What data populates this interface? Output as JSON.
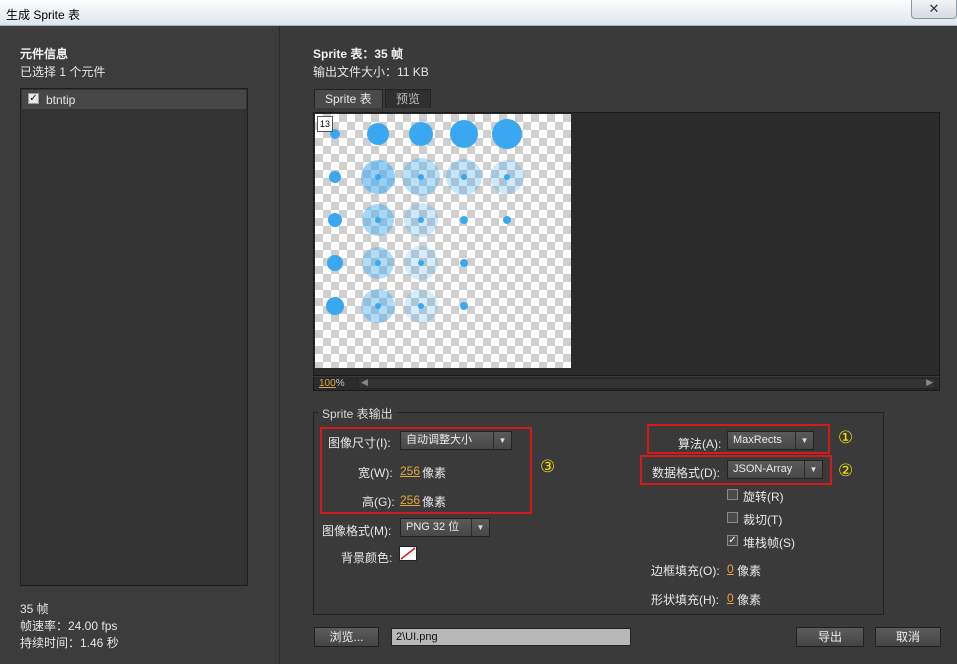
{
  "window": {
    "title": "生成 Sprite 表",
    "close_glyph": "✕"
  },
  "left": {
    "header": "元件信息",
    "selected_count": "已选择 1 个元件",
    "symbols": [
      {
        "name": "btntip",
        "checked": true
      }
    ],
    "frames": "35 帧",
    "frame_rate": "帧速率：24.00 fps",
    "duration": "持续时间：1.46 秒"
  },
  "summary": {
    "title": "Sprite 表：35 帧",
    "file_size": "输出文件大小：11 KB"
  },
  "tabs": [
    {
      "label": "Sprite 表",
      "active": true
    },
    {
      "label": "预览",
      "active": false
    }
  ],
  "preview": {
    "frame_badge": "13",
    "zoom_value": "100",
    "zoom_unit": "%"
  },
  "output": {
    "legend": "Sprite 表输出",
    "image_size_label": "图像尺寸(I):",
    "image_size_value": "自动调整大小",
    "width_label": "宽(W):",
    "width_value": "256",
    "height_label": "高(G):",
    "height_value": "256",
    "pixel_unit": "像素",
    "image_format_label": "图像格式(M):",
    "image_format_value": "PNG 32 位",
    "bg_color_label": "背景颜色:",
    "algorithm_label": "算法(A):",
    "algorithm_value": "MaxRects",
    "data_format_label": "数据格式(D):",
    "data_format_value": "JSON-Array",
    "rotate_label": "旋转(R)",
    "rotate_checked": false,
    "trim_label": "裁切(T)",
    "trim_checked": false,
    "stack_label": "堆栈帧(S)",
    "stack_checked": true,
    "border_pad_label": "边框填充(O):",
    "border_pad_value": "0",
    "shape_pad_label": "形状填充(H):",
    "shape_pad_value": "0",
    "pad_unit": "像素",
    "annotations": [
      "①",
      "②",
      "③"
    ]
  },
  "footer": {
    "browse_label": "浏览...",
    "path_value": "2\\UI.png",
    "export_label": "导出",
    "cancel_label": "取消"
  },
  "colors": {
    "accent_orange": "#e3a63d",
    "highlight_red": "#d01c1c",
    "annotation_yellow": "#f0e000",
    "sprite_blue": "#3aa8f0"
  }
}
